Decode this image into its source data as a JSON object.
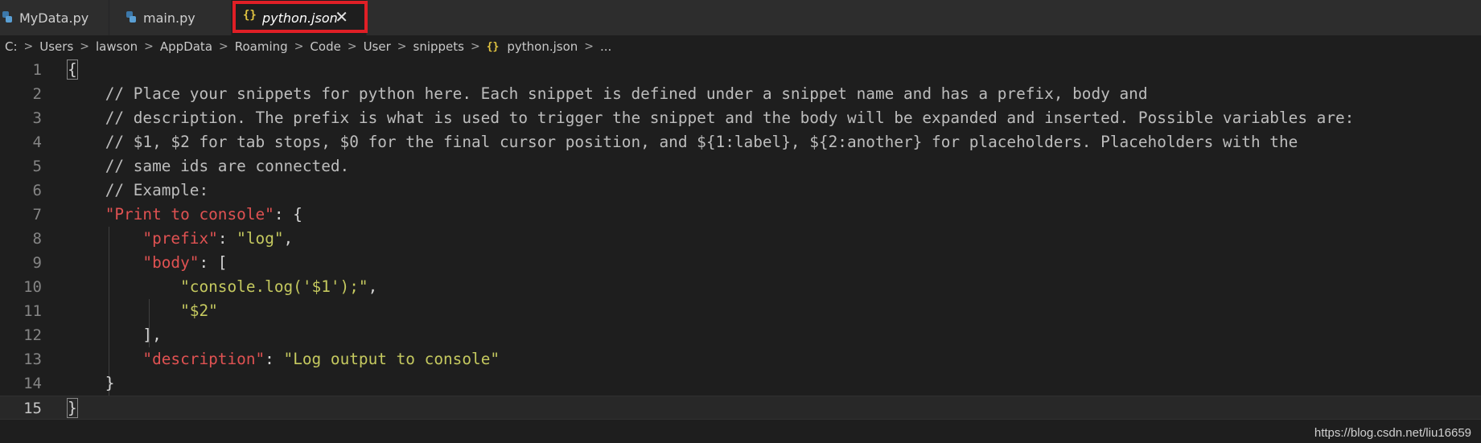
{
  "tabs": [
    {
      "label": "MyData.py",
      "icon": "python-icon",
      "active": false
    },
    {
      "label": "main.py",
      "icon": "python-icon",
      "active": false
    },
    {
      "label": "python.json",
      "icon": "json-braces-icon",
      "active": true
    }
  ],
  "tab_close_glyph": "✕",
  "json_icon_glyph": "{}",
  "breadcrumb": [
    "C:",
    "Users",
    "lawson",
    "AppData",
    "Roaming",
    "Code",
    "User",
    "snippets",
    "python.json",
    "..."
  ],
  "breadcrumb_sep": ">",
  "editor": {
    "current_line": 15,
    "lines": [
      {
        "n": "1",
        "tokens": [
          {
            "t": "{",
            "c": "punc"
          }
        ]
      },
      {
        "n": "2",
        "tokens": [
          {
            "t": "    // Place your snippets for python here. Each snippet is defined under a snippet name and has a prefix, body and",
            "c": "comment"
          }
        ]
      },
      {
        "n": "3",
        "tokens": [
          {
            "t": "    // description. The prefix is what is used to trigger the snippet and the body will be expanded and inserted. Possible variables are:",
            "c": "comment"
          }
        ]
      },
      {
        "n": "4",
        "tokens": [
          {
            "t": "    // $1, $2 for tab stops, $0 for the final cursor position, and ${1:label}, ${2:another} for placeholders. Placeholders with the",
            "c": "comment"
          }
        ]
      },
      {
        "n": "5",
        "tokens": [
          {
            "t": "    // same ids are connected.",
            "c": "comment"
          }
        ]
      },
      {
        "n": "6",
        "tokens": [
          {
            "t": "    // Example:",
            "c": "comment"
          }
        ]
      },
      {
        "n": "7",
        "tokens": [
          {
            "t": "    ",
            "c": "punc"
          },
          {
            "t": "\"Print to console\"",
            "c": "key"
          },
          {
            "t": ": {",
            "c": "punc"
          }
        ]
      },
      {
        "n": "8",
        "tokens": [
          {
            "t": "        ",
            "c": "punc"
          },
          {
            "t": "\"prefix\"",
            "c": "key"
          },
          {
            "t": ": ",
            "c": "punc"
          },
          {
            "t": "\"log\"",
            "c": "str"
          },
          {
            "t": ",",
            "c": "punc"
          }
        ]
      },
      {
        "n": "9",
        "tokens": [
          {
            "t": "        ",
            "c": "punc"
          },
          {
            "t": "\"body\"",
            "c": "key"
          },
          {
            "t": ": [",
            "c": "punc"
          }
        ]
      },
      {
        "n": "10",
        "tokens": [
          {
            "t": "            ",
            "c": "punc"
          },
          {
            "t": "\"console.log('$1');\"",
            "c": "str"
          },
          {
            "t": ",",
            "c": "punc"
          }
        ]
      },
      {
        "n": "11",
        "tokens": [
          {
            "t": "            ",
            "c": "punc"
          },
          {
            "t": "\"$2\"",
            "c": "str"
          }
        ]
      },
      {
        "n": "12",
        "tokens": [
          {
            "t": "        ],",
            "c": "punc"
          }
        ]
      },
      {
        "n": "13",
        "tokens": [
          {
            "t": "        ",
            "c": "punc"
          },
          {
            "t": "\"description\"",
            "c": "key"
          },
          {
            "t": ": ",
            "c": "punc"
          },
          {
            "t": "\"Log output to console\"",
            "c": "str"
          }
        ]
      },
      {
        "n": "14",
        "tokens": [
          {
            "t": "    }",
            "c": "punc"
          }
        ]
      },
      {
        "n": "15",
        "tokens": [
          {
            "t": "}",
            "c": "punc"
          }
        ]
      }
    ]
  },
  "watermark": "https://blog.csdn.net/liu16659"
}
